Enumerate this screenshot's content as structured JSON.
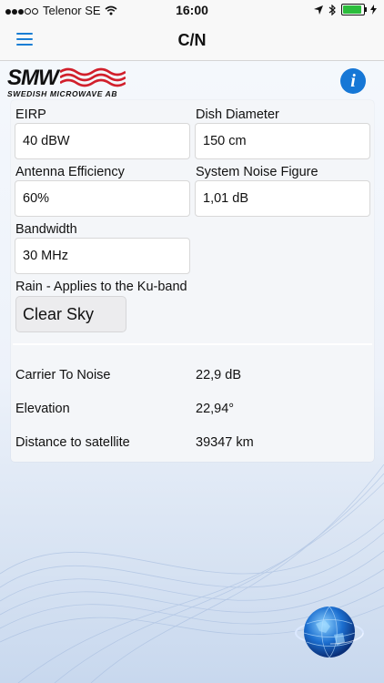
{
  "status_bar": {
    "carrier": "Telenor SE",
    "time": "16:00"
  },
  "nav": {
    "title": "C/N",
    "menu_icon": "hamburger-icon"
  },
  "logo": {
    "mark": "SMW",
    "subtitle": "SWEDISH MICROWAVE AB"
  },
  "info_button": {
    "glyph": "i"
  },
  "form": {
    "eirp": {
      "label": "EIRP",
      "value": "40 dBW"
    },
    "dish_diameter": {
      "label": "Dish Diameter",
      "value": "150 cm"
    },
    "antenna_efficiency": {
      "label": "Antenna Efficiency",
      "value": "60%"
    },
    "system_noise_figure": {
      "label": "System Noise Figure",
      "value": "1,01 dB"
    },
    "bandwidth": {
      "label": "Bandwidth",
      "value": "30 MHz"
    },
    "rain": {
      "label": "Rain - Applies to the Ku-band",
      "value": "Clear Sky"
    }
  },
  "results": {
    "carrier_to_noise": {
      "label": "Carrier To Noise",
      "value": "22,9 dB"
    },
    "elevation": {
      "label": "Elevation",
      "value": "22,94°"
    },
    "distance": {
      "label": "Distance to satellite",
      "value": "39347 km"
    }
  },
  "colors": {
    "accent": "#1677d6",
    "logo_wave": "#d11f2b",
    "battery": "#2bbd3c"
  }
}
